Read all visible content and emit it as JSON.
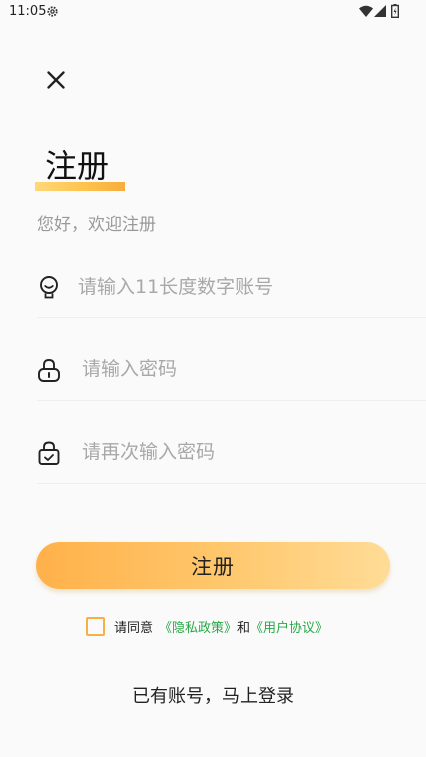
{
  "status_bar": {
    "time": "11:05",
    "icons": [
      "gear-icon",
      "wifi-icon",
      "signal-icon",
      "battery-icon"
    ]
  },
  "header": {
    "close_icon": "close-icon",
    "title": "注册",
    "subtitle": "您好，欢迎注册",
    "accent_gradient": [
      "#ffd87a",
      "#f6ad3e"
    ]
  },
  "form": {
    "account": {
      "icon": "user-badge-icon",
      "placeholder": "请输入11长度数字账号",
      "value": ""
    },
    "password": {
      "icon": "lock-icon",
      "placeholder": "请输入密码",
      "value": ""
    },
    "confirm_password": {
      "icon": "lock-check-icon",
      "placeholder": "请再次输入密码",
      "value": ""
    }
  },
  "submit": {
    "label": "注册",
    "gradient": [
      "#ffb14a",
      "#ffdc96"
    ]
  },
  "agreement": {
    "checked": false,
    "prefix": "请同意",
    "privacy_link": "《隐私政策》",
    "and": "和",
    "user_agreement_link": "《用户协议》",
    "link_color": "#27a847"
  },
  "footer": {
    "login_text": "已有账号，马上登录"
  }
}
